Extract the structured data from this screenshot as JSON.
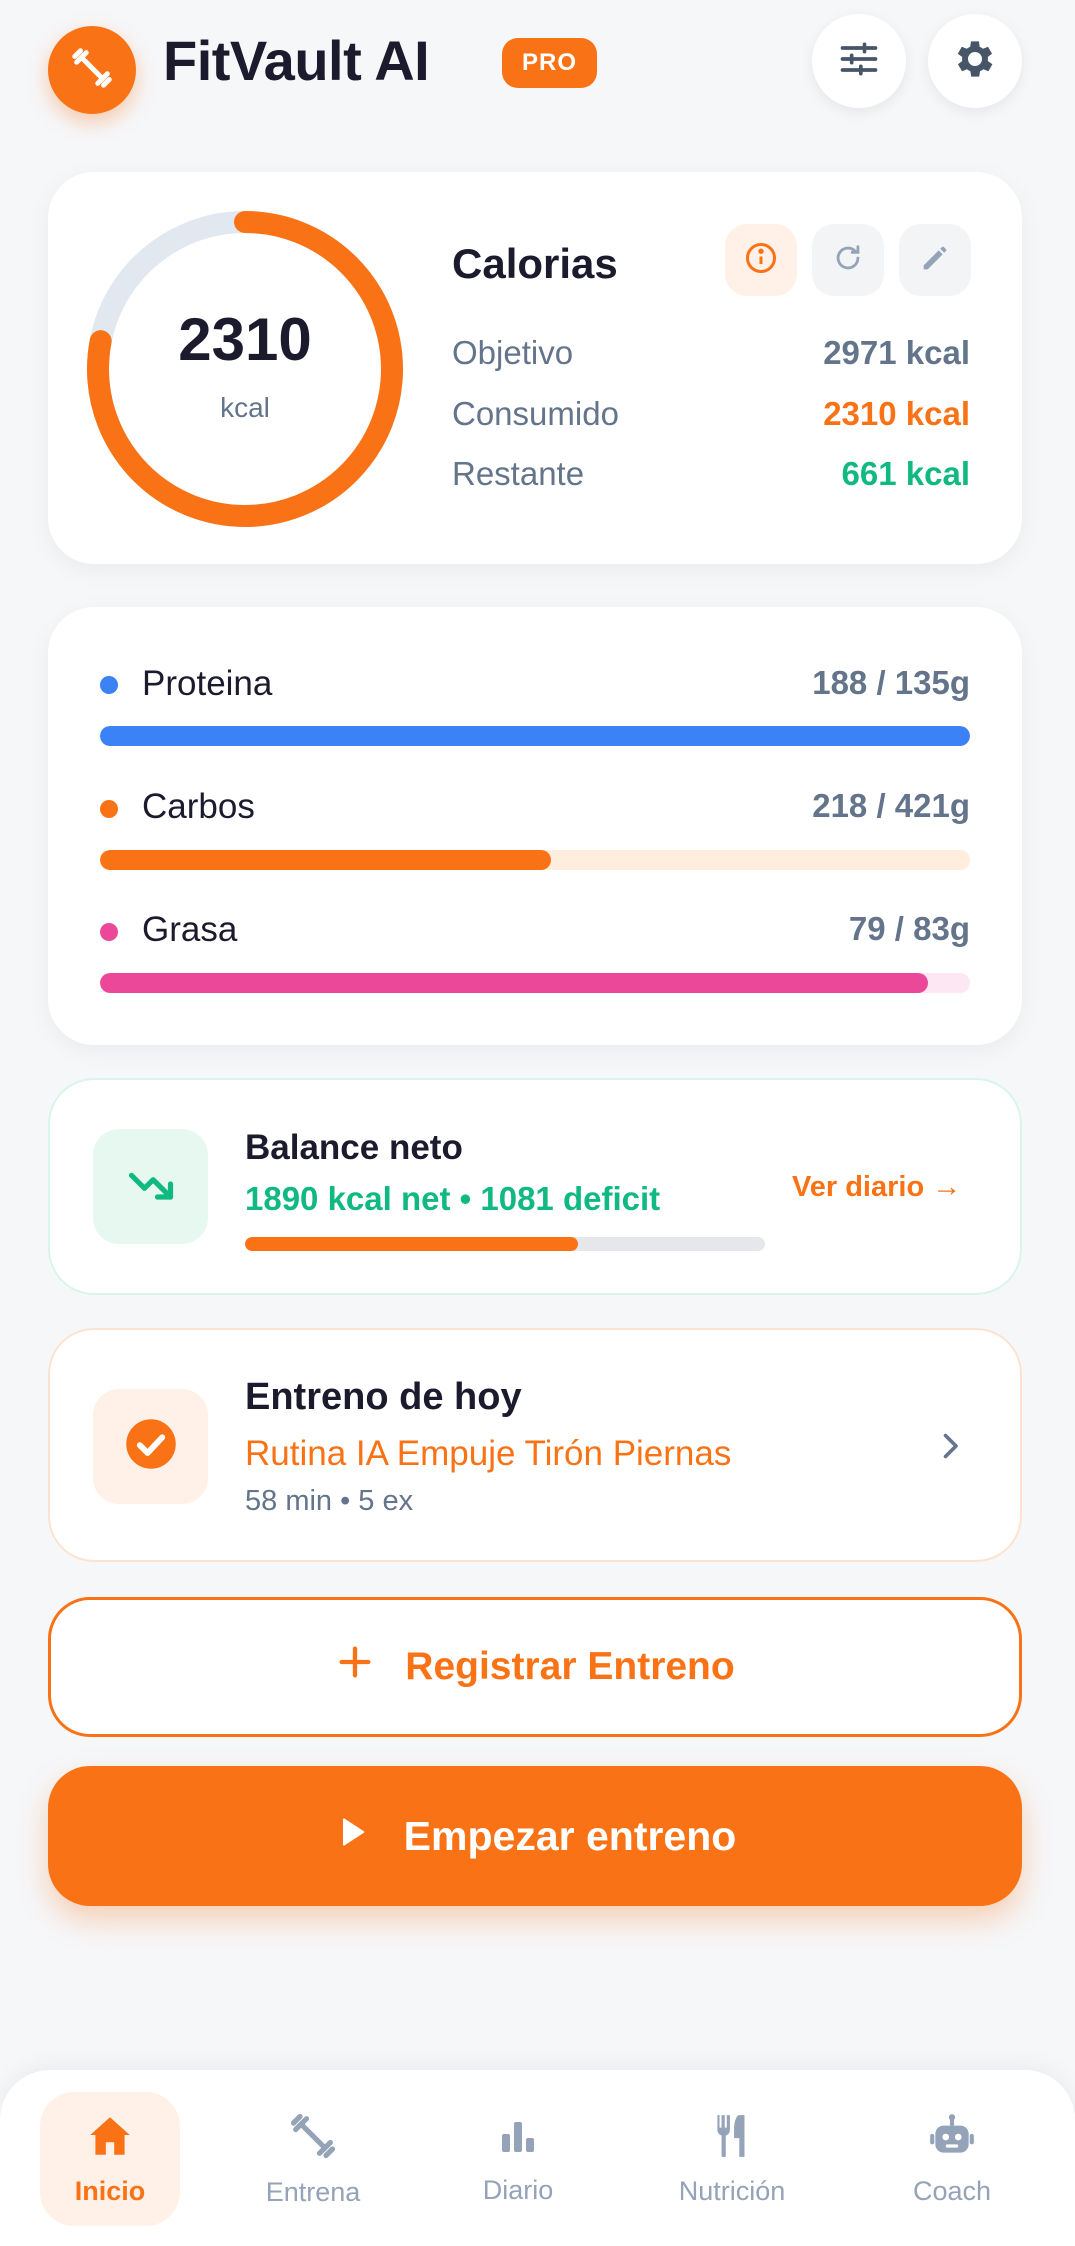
{
  "header": {
    "app_title": "FitVault AI",
    "badge": "PRO",
    "logo_icon": "dumbbell-icon",
    "filters_icon": "sliders-icon",
    "settings_icon": "gear-icon"
  },
  "calories": {
    "title": "Calorias",
    "value": "2310",
    "unit": "kcal",
    "progress": 0.78,
    "rows": [
      {
        "label": "Objetivo",
        "value": "2971 kcal",
        "color": "#64748b"
      },
      {
        "label": "Consumido",
        "value": "2310 kcal",
        "color": "#f97316"
      },
      {
        "label": "Restante",
        "value": "661 kcal",
        "color": "#10b981"
      }
    ],
    "icons": [
      "info-icon",
      "refresh-icon",
      "edit-icon"
    ]
  },
  "macros": [
    {
      "name": "Proteina",
      "value": "188 / 135g",
      "progress": 1.0,
      "color": "#3b82f6",
      "track": "#dbeafe"
    },
    {
      "name": "Carbos",
      "value": "218 / 421g",
      "progress": 0.518,
      "color": "#f97316",
      "track": "#ffeede"
    },
    {
      "name": "Grasa",
      "value": "79 / 83g",
      "progress": 0.952,
      "color": "#ec4899",
      "track": "#fde7f2"
    }
  ],
  "balance": {
    "title": "Balance neto",
    "subtitle": "1890 kcal net • 1081 deficit",
    "progress": 0.64,
    "link": "Ver diario →"
  },
  "workout": {
    "title": "Entreno de hoy",
    "routine": "Rutina IA Empuje Tirón Piernas",
    "meta": "58 min • 5 ex"
  },
  "actions": {
    "register": "Registrar Entreno",
    "start": "Empezar entreno"
  },
  "nav": {
    "items": [
      {
        "label": "Inicio",
        "icon": "home-icon",
        "active": true
      },
      {
        "label": "Entrena",
        "icon": "dumbbell-icon",
        "active": false
      },
      {
        "label": "Diario",
        "icon": "bar-chart-icon",
        "active": false
      },
      {
        "label": "Nutrición",
        "icon": "utensils-icon",
        "active": false
      },
      {
        "label": "Coach",
        "icon": "robot-icon",
        "active": false
      }
    ]
  },
  "colors": {
    "accent": "#f97316",
    "success": "#10b981",
    "muted": "#64748b",
    "text": "#1c1b2e"
  }
}
